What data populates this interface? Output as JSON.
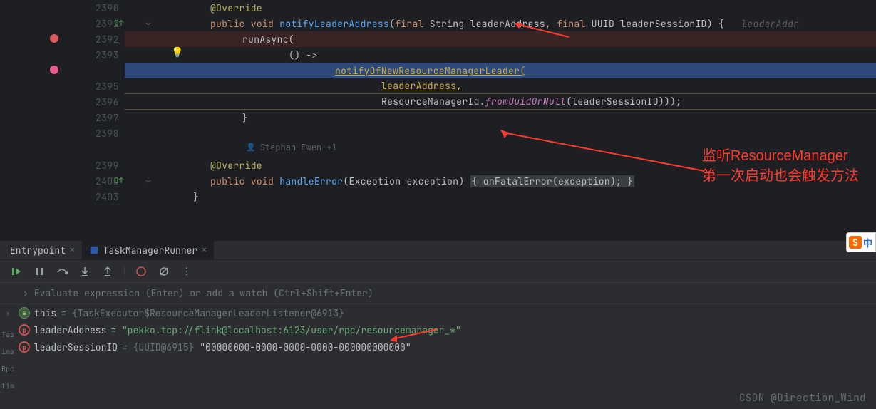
{
  "gutter": {
    "lines": [
      "2390",
      "2391",
      "2392",
      "2393",
      "2395",
      "2396",
      "2397",
      "2398",
      "2399",
      "2400",
      "2403"
    ]
  },
  "code": {
    "l2390": "@Override",
    "l2391_public": "public",
    "l2391_void": "void",
    "l2391_method": "notifyLeaderAddress",
    "l2391_sig": "(final String leaderAddress, final UUID leaderSessionID) {",
    "l2391_hint": "leaderAddr",
    "l2392": "runAsync(",
    "l2393": "() ->",
    "l2394_exec": "notifyOfNewResourceManagerLeader(",
    "l2395": "leaderAddress,",
    "l2396a": "ResourceManagerId.",
    "l2396b": "fromUuidOrNull",
    "l2396c": "(leaderSessionID)));",
    "l2397": "}",
    "author": "Stephan Ewen +1",
    "l2399": "@Override",
    "l2400_public": "public",
    "l2400_void": "void",
    "l2400_method": "handleError",
    "l2400_sig": "(Exception exception) ",
    "l2400_body": "{ onFatalError(exception); }",
    "l2403": "}"
  },
  "tabs": {
    "entrypoint": "Entrypoint",
    "runner": "TaskManagerRunner"
  },
  "toolbar": {
    "play": "▶",
    "pause": "⏸",
    "stop": "■"
  },
  "watch": {
    "placeholder": "Evaluate expression (Enter) or add a watch (Ctrl+Shift+Enter)"
  },
  "vars": {
    "row1_name": "this",
    "row1_val": " = {TaskExecutor$ResourceManagerLeaderListener@6913}",
    "row2_name": "leaderAddress",
    "row2_val": " = \"pekko.tcp://flink@localhost:6123/user/rpc/resourcemanager_*\"",
    "row3_name": "leaderSessionID",
    "row3_val_a": " = {UUID@6915} ",
    "row3_val_b": "\"00000000-0000-0000-0000-000000000000\""
  },
  "sidelabels": [
    "Tas",
    "ime",
    "Rpc",
    "tim"
  ],
  "annotation": {
    "line1": "监听ResourceManager",
    "line2": "第一次启动也会触发方法"
  },
  "badge": {
    "s": "S",
    "ch": "中"
  },
  "watermark": "CSDN @Direction_Wind"
}
